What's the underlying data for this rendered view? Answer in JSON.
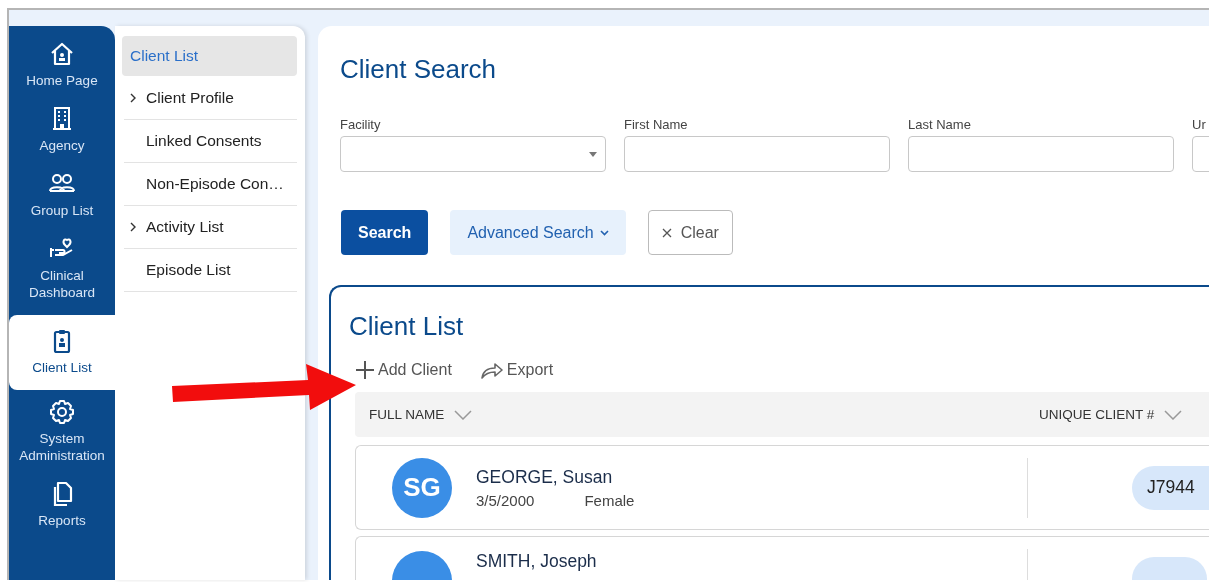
{
  "nav_rail": {
    "items": [
      {
        "label": "Home Page",
        "kind": "home",
        "selected": false
      },
      {
        "label": "Agency",
        "kind": "building",
        "selected": false
      },
      {
        "label": "Group List",
        "kind": "group",
        "selected": false
      },
      {
        "label": "Clinical Dashboard",
        "kind": "care",
        "selected": false
      },
      {
        "label": "Client List",
        "kind": "clipboard",
        "selected": true
      },
      {
        "label": "System Administration",
        "kind": "gear",
        "selected": false
      },
      {
        "label": "Reports",
        "kind": "docs",
        "selected": false
      }
    ]
  },
  "sub_nav": {
    "items": [
      {
        "label": "Client List",
        "kind": "link",
        "selected": true
      },
      {
        "label": "Client Profile",
        "kind": "group",
        "selected": false
      },
      {
        "label": "Linked Consents",
        "kind": "link",
        "selected": false
      },
      {
        "label": "Non-Episode Con…",
        "kind": "link",
        "selected": false
      },
      {
        "label": "Activity List",
        "kind": "group",
        "selected": false
      },
      {
        "label": "Episode List",
        "kind": "link",
        "selected": false
      }
    ]
  },
  "client_search": {
    "title": "Client Search",
    "fields": [
      {
        "label": "Facility",
        "kind": "select"
      },
      {
        "label": "First Name",
        "kind": "text"
      },
      {
        "label": "Last Name",
        "kind": "text"
      },
      {
        "label": "Ur",
        "kind": "text"
      }
    ],
    "buttons": [
      {
        "label": "Search",
        "kind": "primary"
      },
      {
        "label": "Advanced Search",
        "kind": "dropdown"
      },
      {
        "label": "Clear",
        "kind": "clear"
      }
    ]
  },
  "client_list": {
    "title": "Client List",
    "actions": [
      {
        "label": "Add Client",
        "kind": "add"
      },
      {
        "label": "Export",
        "kind": "export"
      }
    ],
    "columns": [
      "FULL NAME",
      "UNIQUE CLIENT #"
    ],
    "rows": [
      {
        "initials": "SG",
        "name": "GEORGE, Susan",
        "dob": "3/5/2000",
        "gender": "Female",
        "client_id": "J7944"
      },
      {
        "name": "SMITH, Joseph"
      }
    ]
  }
}
